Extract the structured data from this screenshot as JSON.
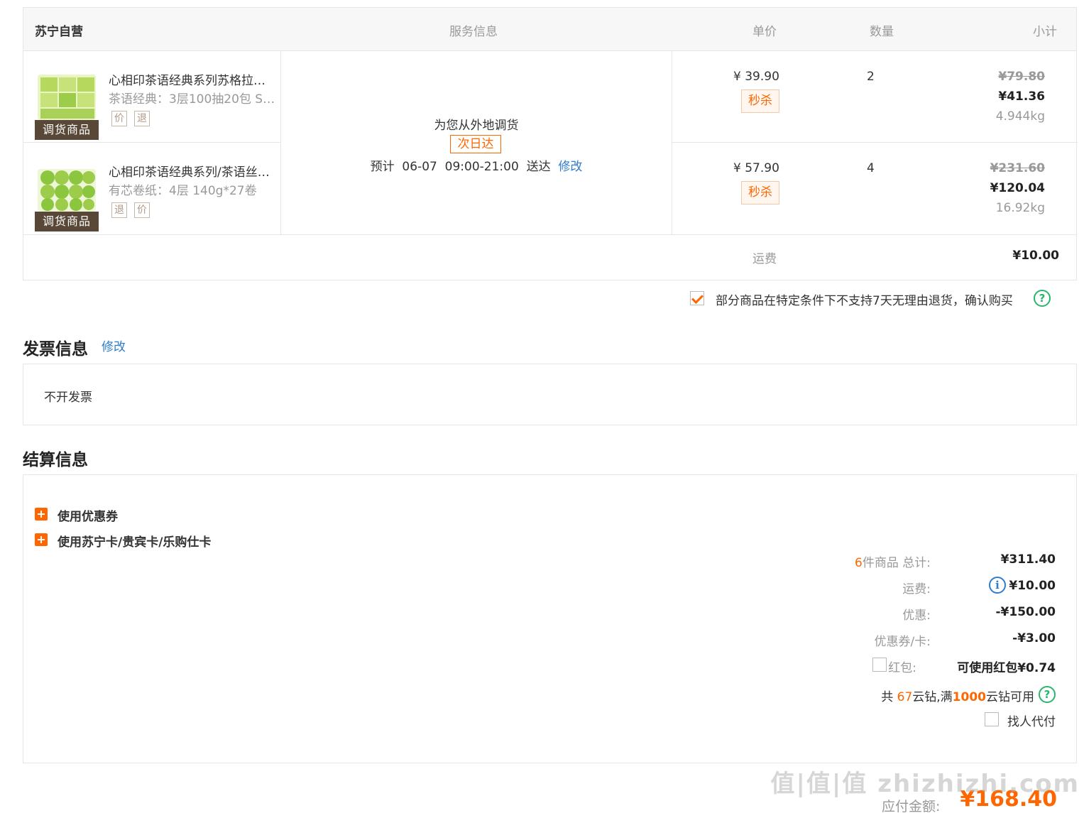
{
  "order": {
    "store": "苏宁自营",
    "col_service": "服务信息",
    "col_price": "单价",
    "col_qty": "数量",
    "col_subtotal": "小计",
    "items": [
      {
        "title": "心相印茶语经典系列苏格拉…",
        "spec": "茶语经典：3层100抽20包 S…",
        "tag": "调货商品",
        "icons": [
          "价",
          "退"
        ],
        "price": "¥ 39.90",
        "promo": "秒杀",
        "qty": "2",
        "orig_subtotal": "¥79.80",
        "subtotal": "¥41.36",
        "weight": "4.944kg"
      },
      {
        "title": "心相印茶语经典系列/茶语丝…",
        "spec": "有芯卷纸：4层 140g*27卷",
        "tag": "调货商品",
        "icons": [
          "退",
          "价"
        ],
        "price": "¥ 57.90",
        "promo": "秒杀",
        "qty": "4",
        "orig_subtotal": "¥231.60",
        "subtotal": "¥120.04",
        "weight": "16.92kg"
      }
    ],
    "service": {
      "note": "为您从外地调货",
      "badge": "次日达",
      "eta_prefix": "预计",
      "eta_date": "06-07",
      "eta_time": "09:00-21:00",
      "eta_suffix": "送达",
      "modify": "修改"
    },
    "shipping_label": "运费",
    "shipping_value": "¥10.00"
  },
  "return_notice": "部分商品在特定条件下不支持7天无理由退货，确认购买",
  "invoice": {
    "title": "发票信息",
    "modify": "修改",
    "value": "不开发票"
  },
  "settlement": {
    "title": "结算信息",
    "coupon_label": "使用优惠券",
    "card_label": "使用苏宁卡/贵宾卡/乐购仕卡",
    "count": "6",
    "total_label": "件商品 总计:",
    "total_value": "¥311.40",
    "shipping_label": "运费:",
    "shipping_value": "¥10.00",
    "discount_label": "优惠:",
    "discount_value": "-¥150.00",
    "coupon_card_label": "优惠券/卡:",
    "coupon_card_value": "-¥3.00",
    "redpacket_label": "红包:",
    "redpacket_value": "可使用红包¥0.74",
    "diamond_prefix": "共",
    "diamond_count": "67",
    "diamond_mid": "云钻,满",
    "diamond_threshold": "1000",
    "diamond_suffix": "云钻可用",
    "proxy_pay": "找人代付"
  },
  "payable": {
    "label": "应付金额:",
    "value": "¥168.40"
  },
  "watermark": "值|值|值 zhizhizhi.com",
  "colors": {
    "accent": "#ff6600",
    "link": "#2e7ccc",
    "green": "#2ab56d"
  }
}
